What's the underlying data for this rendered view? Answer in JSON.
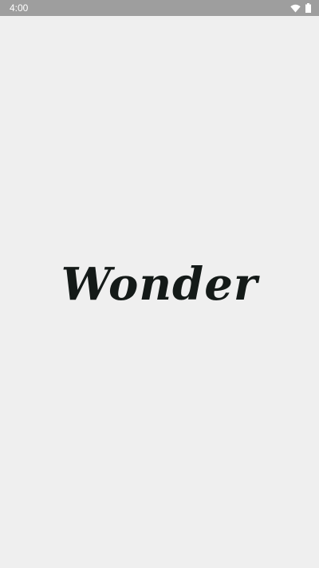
{
  "status_bar": {
    "time": "4:00",
    "icons": [
      "wifi-icon",
      "battery-icon"
    ],
    "background": "#9e9e9e"
  },
  "splash": {
    "logo_text": "Wonder",
    "background": "#efefef",
    "logo_color": "#141a18"
  }
}
